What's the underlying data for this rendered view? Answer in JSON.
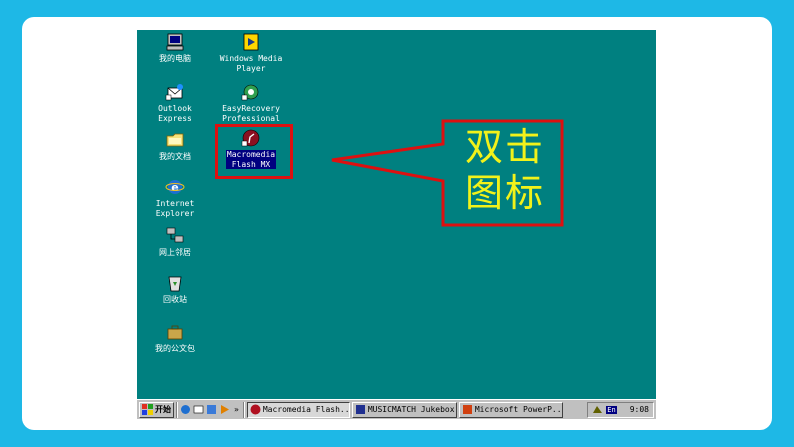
{
  "desktop": {
    "icons": [
      {
        "label": "我的电脑"
      },
      {
        "label": "Outlook\nExpress"
      },
      {
        "label": "我的文档"
      },
      {
        "label": "Internet\nExplorer"
      },
      {
        "label": "网上邻居"
      },
      {
        "label": "回收站"
      },
      {
        "label": "我的公文包"
      },
      {
        "label": "Windows Media\nPlayer"
      },
      {
        "label": "EasyRecovery\nProfessional"
      },
      {
        "label": "Macromedia\nFlash MX"
      }
    ]
  },
  "callout": {
    "text": "双击\n图标"
  },
  "taskbar": {
    "start_label": "开始",
    "chevron": "»",
    "tasks": [
      {
        "label": "Macromedia Flash..."
      },
      {
        "label": "MUSICMATCH Jukebox"
      },
      {
        "label": "Microsoft PowerP..."
      }
    ],
    "language": "En",
    "clock": "9:08"
  },
  "colors": {
    "background": "#1eb8e6",
    "desktop": "#008080",
    "highlight": "#dd1010",
    "callout_text": "#f2f21a",
    "selection": "#000080"
  }
}
